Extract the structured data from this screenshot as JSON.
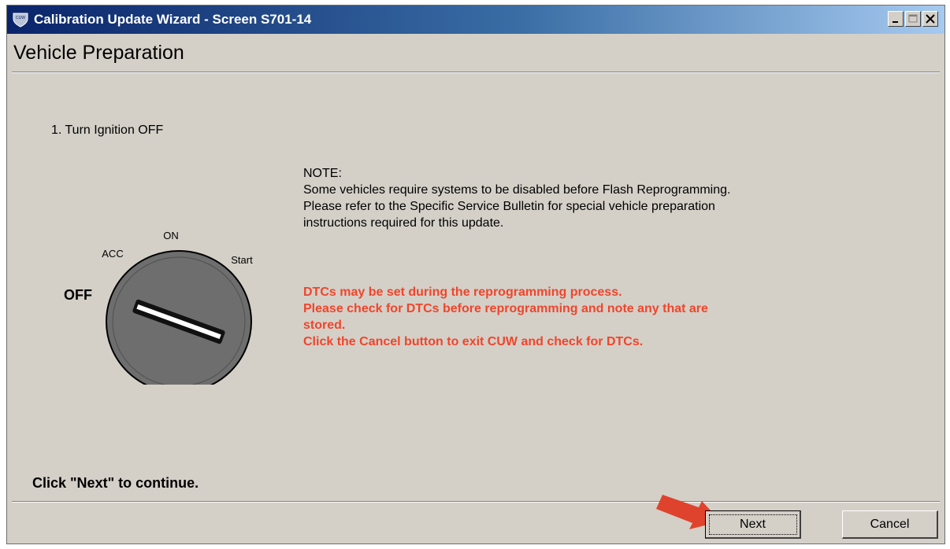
{
  "window": {
    "title": "Calibration Update Wizard - Screen S701-14",
    "icon": "cuw-shield-icon",
    "app_icon_text": "CUW",
    "controls": [
      "minimize-icon",
      "maximize-icon",
      "close-icon"
    ]
  },
  "header": {
    "title": "Vehicle Preparation"
  },
  "content": {
    "step": "1. Turn Ignition OFF",
    "ignition_labels": {
      "acc": "ACC",
      "on": "ON",
      "start": "Start",
      "off": "OFF"
    },
    "note": {
      "heading": "NOTE:",
      "lines": [
        "Some vehicles require systems to be disabled before Flash Reprogramming.",
        "Please refer to the Specific Service Bulletin for special vehicle preparation",
        "instructions required for this update."
      ]
    },
    "warning": {
      "color": "#f0452b",
      "lines": [
        "DTCs may be set during the reprogramming process.",
        "Please check for DTCs before reprogramming and note any that are",
        "stored.",
        "Click the Cancel button to exit CUW and check for DTCs."
      ]
    },
    "instruction": "Click \"Next\" to continue."
  },
  "footer": {
    "next_label": "Next",
    "cancel_label": "Cancel",
    "arrow_color": "#e0432d"
  }
}
